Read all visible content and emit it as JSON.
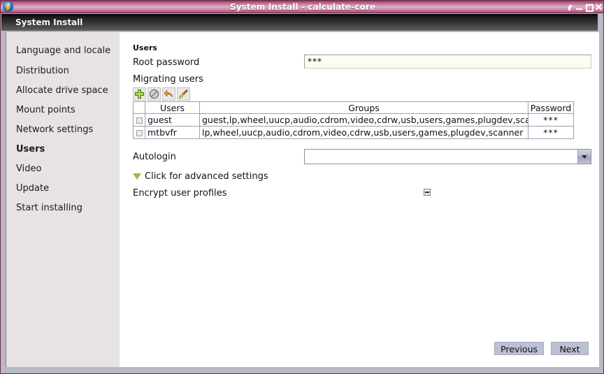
{
  "window": {
    "title": "System Install - calculate-core",
    "app_icon": "calculate-logo-icon",
    "controls": [
      {
        "name": "shade-button",
        "glyph": "shade"
      },
      {
        "name": "minimize-button",
        "glyph": "minimize"
      },
      {
        "name": "maximize-button",
        "glyph": "maximize"
      },
      {
        "name": "close-button",
        "glyph": "close"
      }
    ]
  },
  "app_header": {
    "label": "System Install"
  },
  "sidebar": {
    "items": [
      {
        "label": "Language and locale",
        "active": false
      },
      {
        "label": "Distribution",
        "active": false
      },
      {
        "label": "Allocate drive space",
        "active": false
      },
      {
        "label": "Mount points",
        "active": false
      },
      {
        "label": "Network settings",
        "active": false
      },
      {
        "label": "Users",
        "active": true
      },
      {
        "label": "Video",
        "active": false
      },
      {
        "label": "Update",
        "active": false
      },
      {
        "label": "Start installing",
        "active": false
      }
    ]
  },
  "main": {
    "section_title": "Users",
    "root_password": {
      "label": "Root password",
      "value": "***",
      "placeholder": ""
    },
    "migrating_users": {
      "label": "Migrating users",
      "toolbar": [
        {
          "name": "add-user-button",
          "icon": "plus-icon",
          "enabled": true
        },
        {
          "name": "remove-user-button",
          "icon": "forbidden-icon",
          "enabled": false
        },
        {
          "name": "undo-button",
          "icon": "undo-arrow-icon",
          "enabled": true
        },
        {
          "name": "clear-button",
          "icon": "broom-icon",
          "enabled": true
        }
      ],
      "columns": [
        "",
        "Users",
        "Groups",
        "Password"
      ],
      "rows": [
        {
          "checked": false,
          "user": "guest",
          "groups": "guest,lp,wheel,uucp,audio,cdrom,video,cdrw,usb,users,games,plugdev,scanner",
          "password": "***"
        },
        {
          "checked": false,
          "user": "mtbvfr",
          "groups": "lp,wheel,uucp,audio,cdrom,video,cdrw,usb,users,games,plugdev,scanner",
          "password": "***"
        }
      ]
    },
    "autologin": {
      "label": "Autologin",
      "value": "",
      "placeholder": ""
    },
    "advanced_settings": {
      "label": "Click for advanced settings",
      "expander_icon": "triangle-down-icon",
      "expander_color": "#93c13c"
    },
    "encrypt_user_profiles": {
      "label": "Encrypt user profiles",
      "state": "indeterminate"
    }
  },
  "footer": {
    "previous_label": "Previous",
    "next_label": "Next"
  },
  "colors": {
    "titlebar_accent": "#bf6e93",
    "frame_border": "#6d2a4a",
    "sidebar_bg": "#e6e3e2",
    "content_bg": "#ffffff",
    "input_bg": "#fdfcf0",
    "button_bg": "#bcc0d4",
    "accent_green": "#93c13c"
  }
}
